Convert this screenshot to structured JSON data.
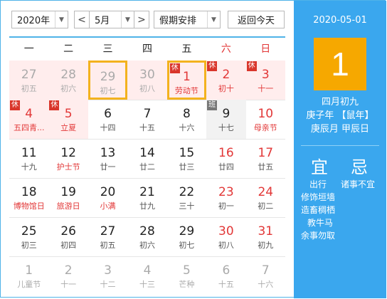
{
  "toolbar": {
    "year": "2020年",
    "month": "5月",
    "prev": "<",
    "next": ">",
    "holiday": "假期安排",
    "today_btn": "返回今天"
  },
  "weekdays": [
    "一",
    "二",
    "三",
    "四",
    "五",
    "六",
    "日"
  ],
  "days": [
    {
      "num": "27",
      "sub": "初五",
      "style": "gray",
      "bg": "holiday",
      "badge": ""
    },
    {
      "num": "28",
      "sub": "初六",
      "style": "gray",
      "bg": "holiday",
      "badge": ""
    },
    {
      "num": "29",
      "sub": "初七",
      "style": "gray",
      "bg": "holiday",
      "badge": "",
      "selected": true
    },
    {
      "num": "30",
      "sub": "初八",
      "style": "gray",
      "bg": "holiday",
      "badge": ""
    },
    {
      "num": "1",
      "sub": "劳动节",
      "style": "red",
      "bg": "holiday",
      "badge": "休",
      "today": true
    },
    {
      "num": "2",
      "sub": "初十",
      "style": "red",
      "bg": "holiday",
      "badge": "休"
    },
    {
      "num": "3",
      "sub": "十一",
      "style": "red",
      "bg": "holiday",
      "badge": "休"
    },
    {
      "num": "4",
      "sub": "五四青...",
      "style": "red",
      "bg": "holiday",
      "badge": "休"
    },
    {
      "num": "5",
      "sub": "立夏",
      "style": "red",
      "bg": "holiday",
      "badge": "休"
    },
    {
      "num": "6",
      "sub": "十四",
      "style": "dark",
      "bg": "",
      "badge": ""
    },
    {
      "num": "7",
      "sub": "十五",
      "style": "dark",
      "bg": "",
      "badge": ""
    },
    {
      "num": "8",
      "sub": "十六",
      "style": "dark",
      "bg": "",
      "badge": ""
    },
    {
      "num": "9",
      "sub": "十七",
      "style": "dark",
      "bg": "workday",
      "badge": "班"
    },
    {
      "num": "10",
      "sub": "母亲节",
      "style": "red",
      "bg": "",
      "badge": ""
    },
    {
      "num": "11",
      "sub": "十九",
      "style": "dark",
      "bg": "",
      "badge": ""
    },
    {
      "num": "12",
      "sub": "护士节",
      "style": "dark",
      "subred": true,
      "bg": "",
      "badge": ""
    },
    {
      "num": "13",
      "sub": "廿一",
      "style": "dark",
      "bg": "",
      "badge": ""
    },
    {
      "num": "14",
      "sub": "廿二",
      "style": "dark",
      "bg": "",
      "badge": ""
    },
    {
      "num": "15",
      "sub": "廿三",
      "style": "dark",
      "bg": "",
      "badge": ""
    },
    {
      "num": "16",
      "sub": "廿四",
      "style": "red",
      "subdark": true,
      "bg": "",
      "badge": ""
    },
    {
      "num": "17",
      "sub": "廿五",
      "style": "red",
      "subdark": true,
      "bg": "",
      "badge": ""
    },
    {
      "num": "18",
      "sub": "博物馆日",
      "style": "dark",
      "subred": true,
      "bg": "",
      "badge": ""
    },
    {
      "num": "19",
      "sub": "旅游日",
      "style": "dark",
      "subred": true,
      "bg": "",
      "badge": ""
    },
    {
      "num": "20",
      "sub": "小满",
      "style": "dark",
      "subred": true,
      "bg": "",
      "badge": ""
    },
    {
      "num": "21",
      "sub": "廿九",
      "style": "dark",
      "bg": "",
      "badge": ""
    },
    {
      "num": "22",
      "sub": "三十",
      "style": "dark",
      "bg": "",
      "badge": ""
    },
    {
      "num": "23",
      "sub": "初一",
      "style": "red",
      "subdark": true,
      "bg": "",
      "badge": ""
    },
    {
      "num": "24",
      "sub": "初二",
      "style": "red",
      "subdark": true,
      "bg": "",
      "badge": ""
    },
    {
      "num": "25",
      "sub": "初三",
      "style": "dark",
      "bg": "",
      "badge": ""
    },
    {
      "num": "26",
      "sub": "初四",
      "style": "dark",
      "bg": "",
      "badge": ""
    },
    {
      "num": "27",
      "sub": "初五",
      "style": "dark",
      "bg": "",
      "badge": ""
    },
    {
      "num": "28",
      "sub": "初六",
      "style": "dark",
      "bg": "",
      "badge": ""
    },
    {
      "num": "29",
      "sub": "初七",
      "style": "dark",
      "bg": "",
      "badge": ""
    },
    {
      "num": "30",
      "sub": "初八",
      "style": "red",
      "subdark": true,
      "bg": "",
      "badge": ""
    },
    {
      "num": "31",
      "sub": "初九",
      "style": "red",
      "subdark": true,
      "bg": "",
      "badge": ""
    },
    {
      "num": "1",
      "sub": "儿童节",
      "style": "gray",
      "bg": "",
      "badge": ""
    },
    {
      "num": "2",
      "sub": "十一",
      "style": "gray",
      "bg": "",
      "badge": ""
    },
    {
      "num": "3",
      "sub": "十二",
      "style": "gray",
      "bg": "",
      "badge": ""
    },
    {
      "num": "4",
      "sub": "十三",
      "style": "gray",
      "bg": "",
      "badge": ""
    },
    {
      "num": "5",
      "sub": "芒种",
      "style": "gray",
      "bg": "",
      "badge": ""
    },
    {
      "num": "6",
      "sub": "十五",
      "style": "gray",
      "bg": "",
      "badge": ""
    },
    {
      "num": "7",
      "sub": "十六",
      "style": "gray",
      "bg": "",
      "badge": ""
    }
  ],
  "side": {
    "date": "2020-05-01",
    "day": "1",
    "lunar1": "四月初九",
    "lunar2": "庚子年 【鼠年】",
    "lunar3": "庚辰月 甲辰日",
    "yi": "宜",
    "ji": "忌",
    "yi_items": [
      "出行",
      "修饰垣墙",
      "造畜稠栖",
      "教牛马",
      "余事勿取"
    ],
    "ji_items": [
      "诸事不宜"
    ]
  },
  "colors": {
    "accent": "#3aa7ee",
    "today": "#f6a800",
    "holiday_bg": "#ffeded",
    "red": "#e23737"
  }
}
